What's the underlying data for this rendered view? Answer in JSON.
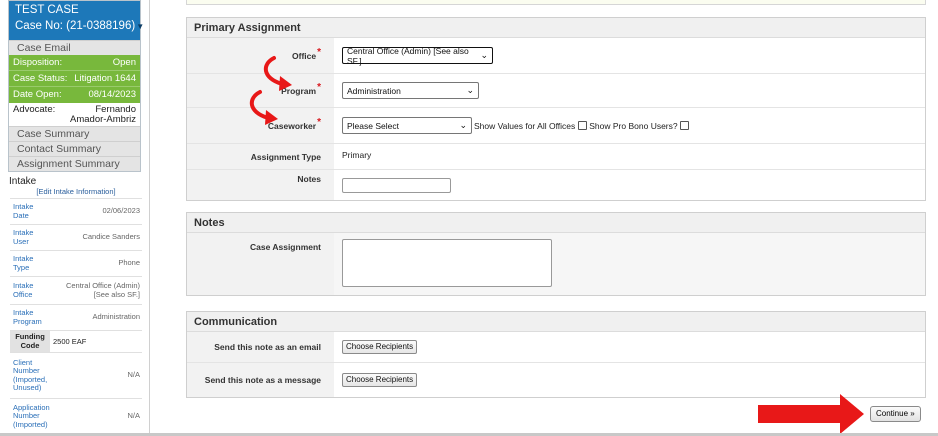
{
  "colors": {
    "case_header_bg": "#1d78b9",
    "disposition_bg": "#78b83c",
    "required_star": "#d8181e",
    "annotation_arrow": "#e81818",
    "link": "#2a6fb8"
  },
  "case": {
    "title": "TEST CASE",
    "number": "Case No: (21-0388196)",
    "dropdown_icon": "triangle-down",
    "email_link": "Case Email",
    "disposition": {
      "label": "Disposition:",
      "value": "Open"
    },
    "status": {
      "label": "Case Status:",
      "value": "Litigation 1644"
    },
    "date_open": {
      "label": "Date Open:",
      "value": "08/14/2023"
    },
    "advocate": {
      "label": "Advocate:",
      "value_line1": "Fernando",
      "value_line2": "Amador-Ambriz"
    },
    "links": [
      "Case Summary",
      "Contact Summary",
      "Assignment Summary"
    ]
  },
  "intake": {
    "title": "Intake",
    "edit_link": "[Edit Intake Information]",
    "rows": [
      {
        "k1": "Intake",
        "k2": "Date",
        "k3": "",
        "k4": "",
        "v1": "02/06/2023",
        "v2": ""
      },
      {
        "k1": "Intake",
        "k2": "User",
        "k3": "",
        "k4": "",
        "v1": "Candice Sanders",
        "v2": ""
      },
      {
        "k1": "Intake",
        "k2": "Type",
        "k3": "",
        "k4": "",
        "v1": "Phone",
        "v2": ""
      },
      {
        "k1": "Intake",
        "k2": "Office",
        "k3": "",
        "k4": "",
        "v1": "Central Office (Admin)",
        "v2": "[See also SF.]"
      },
      {
        "k1": "Intake",
        "k2": "Program",
        "k3": "",
        "k4": "",
        "v1": "Administration",
        "v2": ""
      }
    ],
    "funding": {
      "k1": "Funding",
      "k2": "Code",
      "value": "2500 EAF"
    },
    "rows2": [
      {
        "k1": "Client",
        "k2": "Number",
        "k3": "(Imported,",
        "k4": "Unused)",
        "v1": "N/A"
      },
      {
        "k1": "Application",
        "k2": "Number",
        "k3": "(Imported)",
        "k4": "",
        "v1": "N/A"
      }
    ]
  },
  "primary_assignment": {
    "title": "Primary Assignment",
    "office": {
      "label": "Office",
      "required": "*",
      "value": "Central Office (Admin) [See also SF.]"
    },
    "program": {
      "label": "Program",
      "required": "*",
      "value": "Administration"
    },
    "caseworker": {
      "label": "Caseworker",
      "required": "*",
      "value": "Please Select",
      "show_all_label": "Show Values for All Offices",
      "show_all_checked": false,
      "pro_bono_label": "Show Pro Bono Users?",
      "pro_bono_checked": false
    },
    "assignment_type": {
      "label": "Assignment Type",
      "value": "Primary"
    },
    "notes": {
      "label": "Notes",
      "value": ""
    }
  },
  "notes_section": {
    "title": "Notes",
    "case_assignment": {
      "label": "Case Assignment",
      "value": ""
    }
  },
  "communication": {
    "title": "Communication",
    "email": {
      "label": "Send this note as an email",
      "button": "Choose Recipients"
    },
    "message": {
      "label": "Send this note as a message",
      "button": "Choose Recipients"
    }
  },
  "continue_button": "Continue »"
}
